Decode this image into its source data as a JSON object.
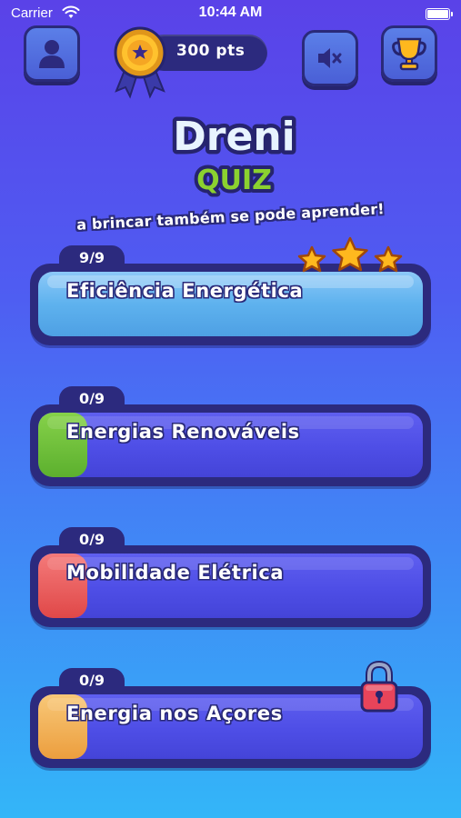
{
  "status_bar": {
    "carrier": "Carrier",
    "time": "10:44 AM"
  },
  "header": {
    "points": "300 pts"
  },
  "logo": {
    "line1": "Dreni",
    "line2": "QUIZ"
  },
  "tagline": "a brincar também se pode aprender!",
  "colors": {
    "card_outline": "#2c2a7e",
    "card_fill": "#4e4ee6",
    "completed_fill": "#5eb2ee",
    "star": "#ffb81e"
  },
  "quizzes": [
    {
      "title": "Eficiência Energética",
      "progress": "9/9",
      "progress_fraction": 1.0,
      "accent_color": "#5eb2ee",
      "stars": 3,
      "locked": false
    },
    {
      "title": "Energias Renováveis",
      "progress": "0/9",
      "progress_fraction": 0,
      "accent_color": "#6ac13a",
      "stars": 0,
      "locked": false
    },
    {
      "title": "Mobilidade Elétrica",
      "progress": "0/9",
      "progress_fraction": 0,
      "accent_color": "#ec5a5a",
      "stars": 0,
      "locked": false
    },
    {
      "title": "Energia nos Açores",
      "progress": "0/9",
      "progress_fraction": 0,
      "accent_color": "#f4b25a",
      "stars": 0,
      "locked": true
    }
  ]
}
